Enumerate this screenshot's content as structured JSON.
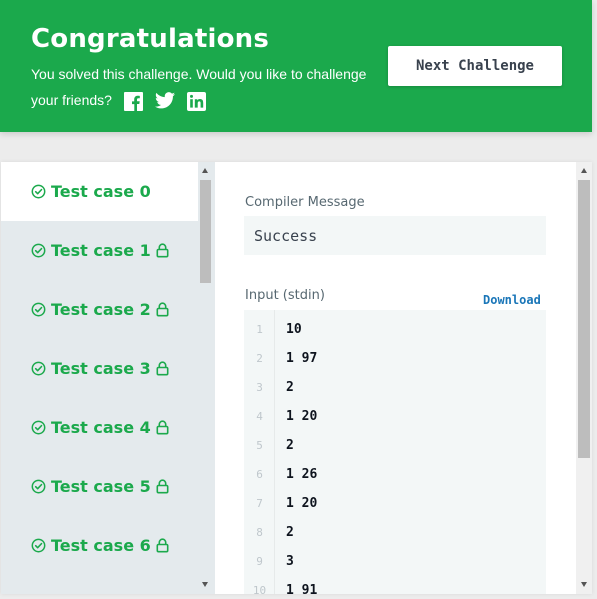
{
  "banner": {
    "title": "Congratulations",
    "message": "You solved this challenge. Would you like to challenge your friends?",
    "social_icons": [
      "facebook-icon",
      "twitter-icon",
      "linkedin-icon"
    ],
    "next_button": "Next Challenge",
    "color": "#1ba94c"
  },
  "tabs": [
    {
      "label": "Test case 0",
      "locked": false,
      "active": true
    },
    {
      "label": "Test case 1",
      "locked": true,
      "active": false
    },
    {
      "label": "Test case 2",
      "locked": true,
      "active": false
    },
    {
      "label": "Test case 3",
      "locked": true,
      "active": false
    },
    {
      "label": "Test case 4",
      "locked": true,
      "active": false
    },
    {
      "label": "Test case 5",
      "locked": true,
      "active": false
    },
    {
      "label": "Test case 6",
      "locked": true,
      "active": false
    }
  ],
  "result": {
    "compiler_label": "Compiler Message",
    "compiler_message": "Success",
    "input_label": "Input (stdin)",
    "download_label": "Download",
    "input_lines": [
      {
        "n": "1",
        "text": "10"
      },
      {
        "n": "2",
        "text": "1 97"
      },
      {
        "n": "3",
        "text": "2"
      },
      {
        "n": "4",
        "text": "1 20"
      },
      {
        "n": "5",
        "text": "2"
      },
      {
        "n": "6",
        "text": "1 26"
      },
      {
        "n": "7",
        "text": "1 20"
      },
      {
        "n": "8",
        "text": "2"
      },
      {
        "n": "9",
        "text": "3"
      },
      {
        "n": "10",
        "text": "1 91"
      }
    ]
  }
}
